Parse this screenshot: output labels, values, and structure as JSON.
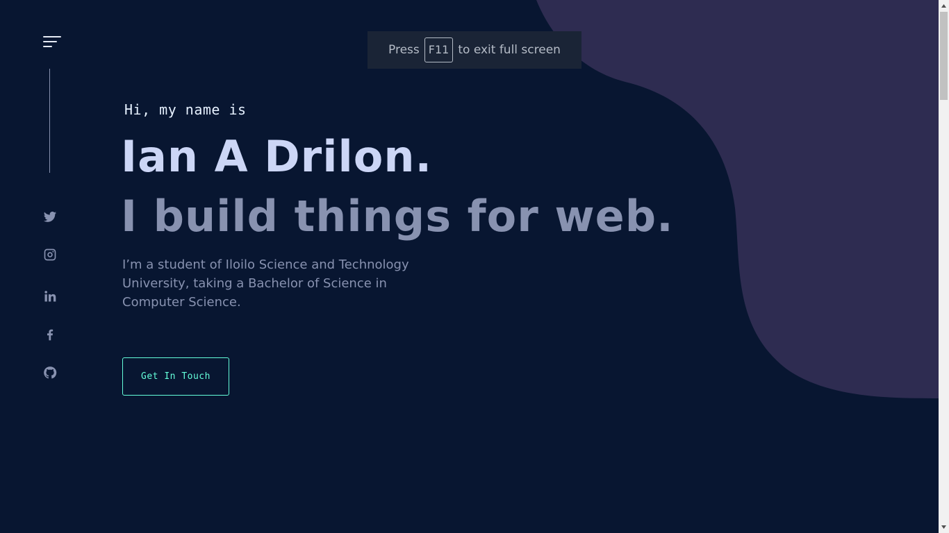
{
  "fullscreen_notice": {
    "before": "Press",
    "key": "F11",
    "after": "to exit full screen"
  },
  "sidebar": {
    "menu_icon": "hamburger-menu-icon",
    "socials": [
      {
        "name": "twitter",
        "icon": "twitter-icon"
      },
      {
        "name": "instagram",
        "icon": "instagram-icon"
      },
      {
        "name": "linkedin",
        "icon": "linkedin-icon"
      },
      {
        "name": "facebook",
        "icon": "facebook-icon"
      },
      {
        "name": "github",
        "icon": "github-icon"
      }
    ]
  },
  "hero": {
    "greeting": "Hi, my name is",
    "name": "Ian A Drilon.",
    "tagline": "I build things for web.",
    "bio": "I’m a student of Iloilo Science and Technology University, taking a Bachelor of Science in Computer Science.",
    "cta_label": "Get In Touch"
  },
  "colors": {
    "background": "#081631",
    "blob": "#2e2c51",
    "accent": "#64ffda",
    "heading": "#ccd6f6",
    "muted": "#8892b0"
  }
}
